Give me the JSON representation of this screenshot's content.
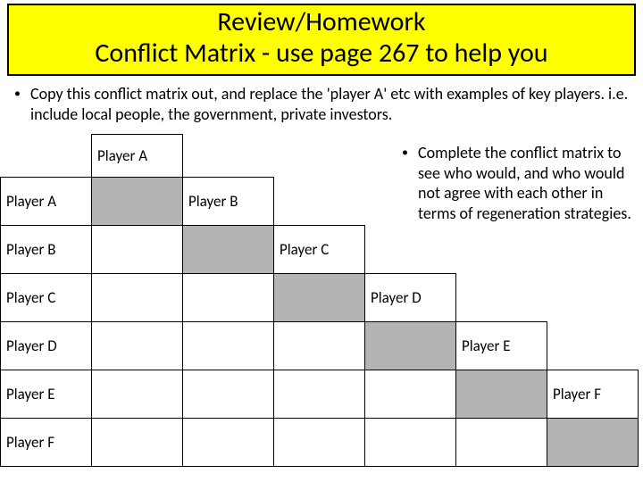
{
  "title": {
    "line1": "Review/Homework",
    "line2": "Conflict Matrix - use page 267 to help you"
  },
  "intro_bullet": "Copy this conflict matrix out, and replace the 'player A' etc with examples of key players. i.e. include local people, the government, private investors.",
  "side_bullet": "Complete the conflict matrix to see who would, and who would not agree with each other in terms of regeneration strategies.",
  "players": {
    "a": "Player A",
    "b": "Player B",
    "c": "Player C",
    "d": "Player D",
    "e": "Player E",
    "f": "Player F"
  }
}
